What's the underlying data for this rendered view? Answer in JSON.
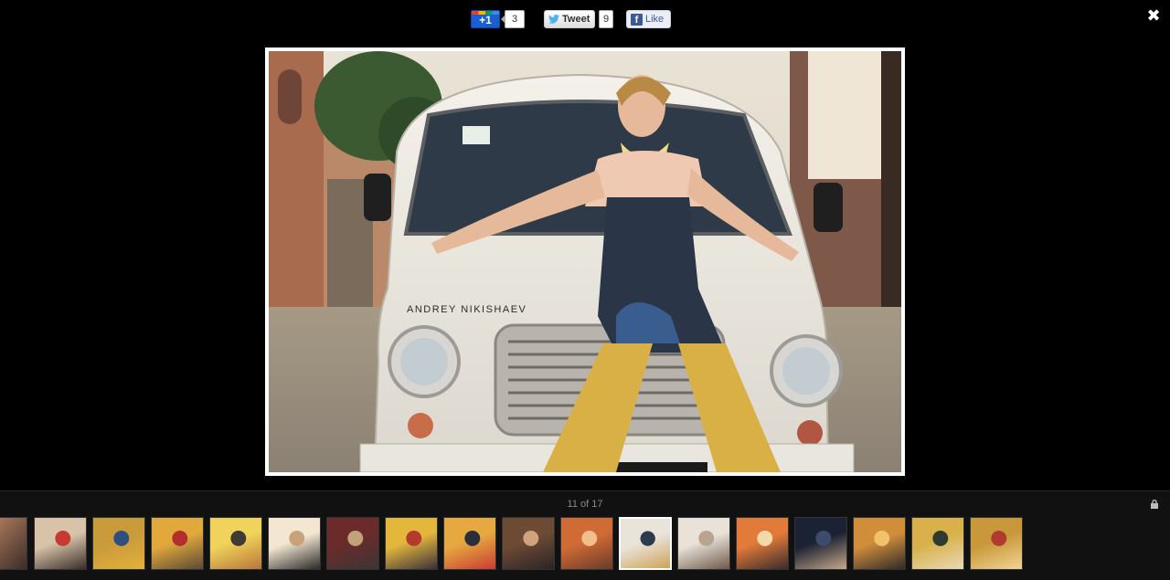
{
  "share": {
    "gplus_label": "+1",
    "gplus_count": "3",
    "tweet_label": "Tweet",
    "tweet_count": "9",
    "like_label": "Like"
  },
  "viewer": {
    "close_glyph": "✖",
    "watermark": "ANDREY NIKISHAEV",
    "counter": "11 of 17",
    "current_index": 11,
    "total": 17
  },
  "thumbnails": [
    {
      "name": "thumbnail-1",
      "colors": [
        "#d8c3a8",
        "#c73a32",
        "#3a2e2a"
      ]
    },
    {
      "name": "thumbnail-2",
      "colors": [
        "#c99b3b",
        "#2f4f7f",
        "#e2b13a"
      ]
    },
    {
      "name": "thumbnail-3",
      "colors": [
        "#e1a83c",
        "#b22f2f",
        "#5a4a36"
      ]
    },
    {
      "name": "thumbnail-4",
      "colors": [
        "#f0d35a",
        "#3f3a34",
        "#b8753a"
      ]
    },
    {
      "name": "thumbnail-5",
      "colors": [
        "#f3e7d2",
        "#c9a27a",
        "#2a2a2a"
      ]
    },
    {
      "name": "thumbnail-6",
      "colors": [
        "#6b2b2b",
        "#c1a37a",
        "#3b3636"
      ]
    },
    {
      "name": "thumbnail-7",
      "colors": [
        "#e3b63c",
        "#b33a2d",
        "#39303a"
      ]
    },
    {
      "name": "thumbnail-8",
      "colors": [
        "#e6a93f",
        "#2b2f3b",
        "#c93b33"
      ]
    },
    {
      "name": "thumbnail-9",
      "colors": [
        "#6d4a34",
        "#d0a37c",
        "#2b2426"
      ]
    },
    {
      "name": "thumbnail-10",
      "colors": [
        "#d06b35",
        "#f1c08a",
        "#6a3b2b"
      ]
    },
    {
      "name": "thumbnail-11",
      "colors": [
        "#e9e4da",
        "#2d3b4f",
        "#cfa25a"
      ]
    },
    {
      "name": "thumbnail-12",
      "colors": [
        "#e8e2d8",
        "#b9a48f",
        "#6d5a48"
      ]
    },
    {
      "name": "thumbnail-13",
      "colors": [
        "#e27a3a",
        "#f4d9a8",
        "#3a2b2b"
      ]
    },
    {
      "name": "thumbnail-14",
      "colors": [
        "#1b2234",
        "#3d4c6d",
        "#c8a88a"
      ]
    },
    {
      "name": "thumbnail-15",
      "colors": [
        "#d08e3b",
        "#f0c26a",
        "#2f2a2a"
      ]
    },
    {
      "name": "thumbnail-16",
      "colors": [
        "#d8b14a",
        "#2f3b2f",
        "#e8d9b5"
      ]
    },
    {
      "name": "thumbnail-17",
      "colors": [
        "#c9983a",
        "#b03a2e",
        "#f1d494"
      ]
    }
  ]
}
